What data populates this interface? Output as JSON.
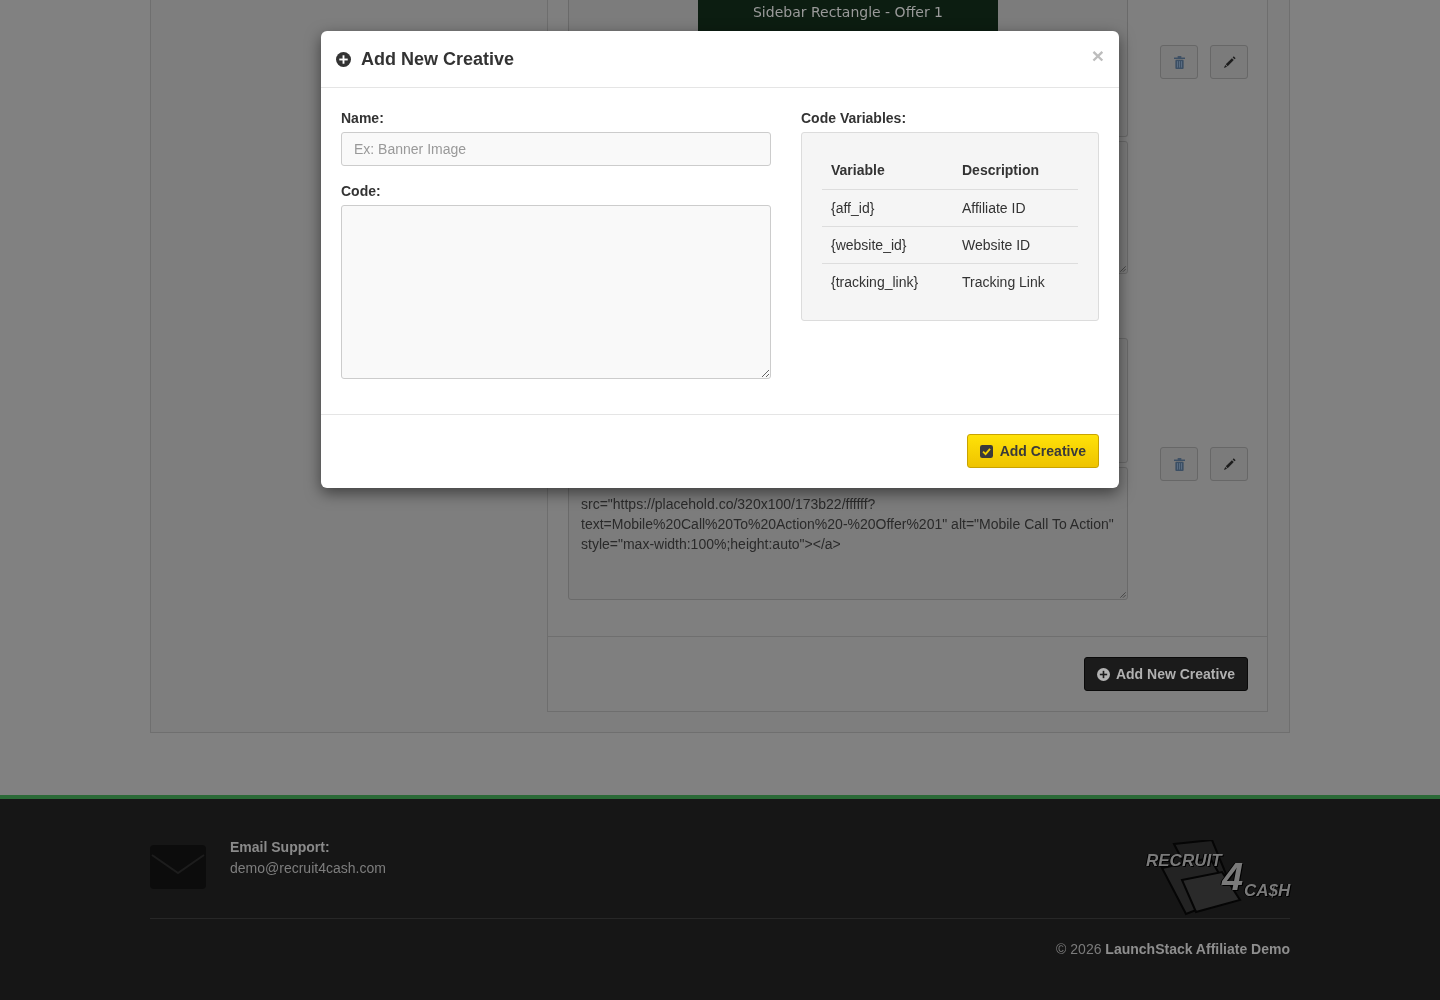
{
  "page": {
    "creatives": [
      {
        "preview": {
          "text": "Sidebar Rectangle - Offer 1"
        }
      },
      {
        "code": "src=\"https://placehold.co/320x100/173b22/ffffff?\ntext=Mobile%20Call%20To%20Action%20-%20Offer%201\" alt=\"Mobile Call To Action\"\nstyle=\"max-width:100%;height:auto\"></a>"
      }
    ],
    "add_button": "Add New Creative"
  },
  "modal": {
    "title": "Add New Creative",
    "close": "×",
    "fields": [
      {
        "kind": "input",
        "label": "Name:",
        "placeholder": "Ex: Banner Image"
      },
      {
        "kind": "textarea",
        "label": "Code:"
      }
    ],
    "variables": {
      "label": "Code Variables:",
      "columns": [
        "Variable",
        "Description"
      ],
      "rows": [
        [
          "{aff_id}",
          "Affiliate ID"
        ],
        [
          "{website_id}",
          "Website ID"
        ],
        [
          "{tracking_link}",
          "Tracking Link"
        ]
      ]
    },
    "submit": "Add Creative"
  },
  "footer": {
    "email_label": "Email Support:",
    "email": "demo@recruit4cash.com",
    "logo_words": [
      "RECRUIT",
      "4",
      "CA$H"
    ],
    "copyright": "© 2026 **LaunchStack Affiliate Demo**"
  }
}
